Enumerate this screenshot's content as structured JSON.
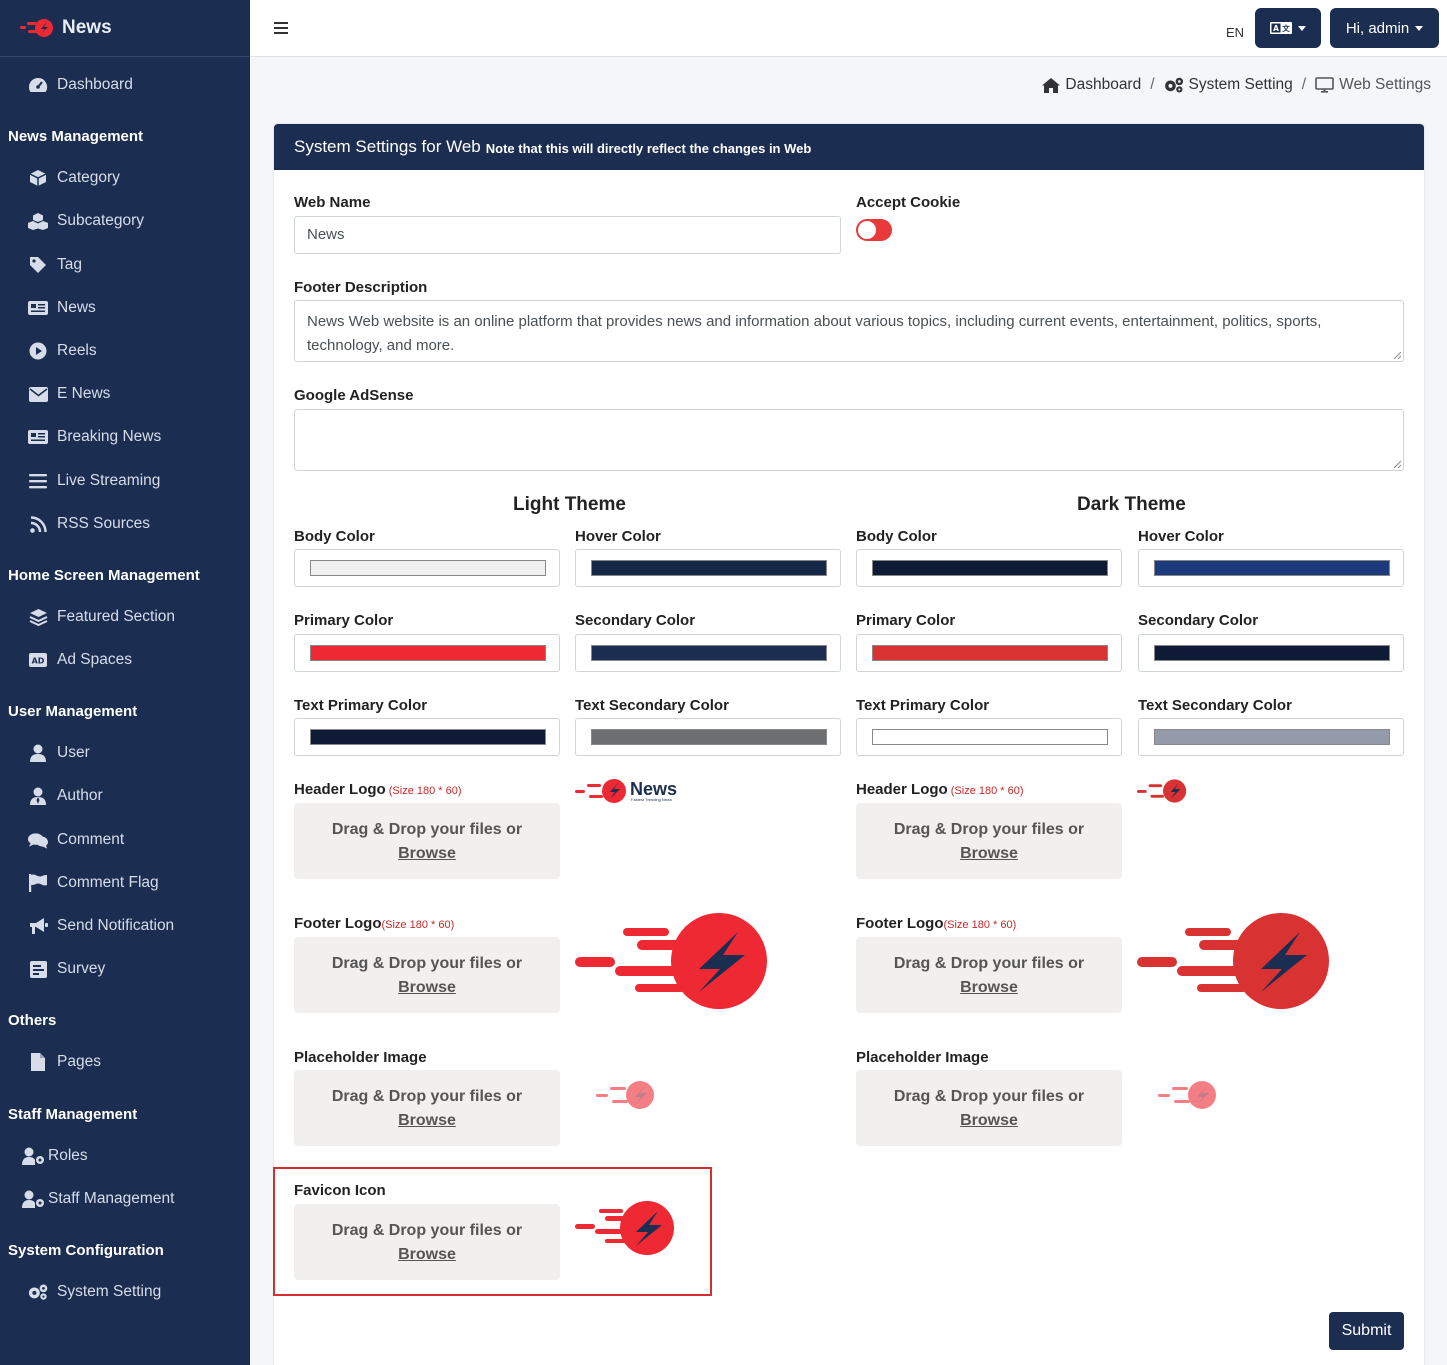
{
  "brand": {
    "name": "News"
  },
  "sidebar": {
    "dashboard": "Dashboard",
    "sections": {
      "news_management": "News Management",
      "home_screen_management": "Home Screen Management",
      "user_management": "User Management",
      "others": "Others",
      "staff_management": "Staff Management",
      "system_configuration": "System Configuration"
    },
    "items": {
      "category": "Category",
      "subcategory": "Subcategory",
      "tag": "Tag",
      "news": "News",
      "reels": "Reels",
      "enews": "E News",
      "breaking_news": "Breaking News",
      "live_streaming": "Live Streaming",
      "rss_sources": "RSS Sources",
      "featured_section": "Featured Section",
      "ad_spaces": "Ad Spaces",
      "user": "User",
      "author": "Author",
      "comment": "Comment",
      "comment_flag": "Comment Flag",
      "send_notification": "Send Notification",
      "survey": "Survey",
      "pages": "Pages",
      "roles": "Roles",
      "staff_management": "Staff Management",
      "system_setting": "System Setting"
    }
  },
  "topbar": {
    "lang": "EN",
    "user_menu": "Hi, admin"
  },
  "breadcrumb": {
    "dashboard": "Dashboard",
    "system_setting": "System Setting",
    "web_settings": "Web Settings"
  },
  "card": {
    "title": "System Settings for Web",
    "note": "Note that this will directly reflect the changes in Web"
  },
  "form": {
    "web_name_label": "Web Name",
    "web_name_value": "News",
    "accept_cookie_label": "Accept Cookie",
    "accept_cookie_on": true,
    "footer_description_label": "Footer Description",
    "footer_description_value": "News Web website is an online platform that provides news and information about various topics, including current events, entertainment, politics, sports, technology, and more.",
    "google_adsense_label": "Google AdSense",
    "google_adsense_value": ""
  },
  "themes": {
    "light_title": "Light Theme",
    "dark_title": "Dark Theme",
    "labels": {
      "body": "Body Color",
      "hover": "Hover Color",
      "primary": "Primary Color",
      "secondary": "Secondary Color",
      "text_primary": "Text Primary Color",
      "text_secondary": "Text Secondary Color"
    },
    "light_colors": {
      "body": "#f0f0f0",
      "hover": "#172748",
      "primary": "#ee2934",
      "secondary": "#1b2d51",
      "text_primary": "#0e1a36",
      "text_secondary": "#6d6e70"
    },
    "dark_colors": {
      "body": "#0e1a36",
      "hover": "#1d3a7d",
      "primary": "#d83232",
      "secondary": "#0e1a36",
      "text_primary": "#ffffff",
      "text_secondary": "#949aaa"
    }
  },
  "uploads": {
    "header_logo_label": "Header Logo",
    "footer_logo_label": "Footer Logo",
    "placeholder_label": "Placeholder Image",
    "favicon_label": "Favicon Icon",
    "size_hint_paren": " (Size 180 * 60)",
    "size_hint": "(Size 180 * 60)",
    "drop_text": "Drag & Drop your files or",
    "browse_text": "Browse",
    "logo_word": "News",
    "logo_tagline": "Fastest Trending News"
  },
  "submit_label": "Submit",
  "colors": {
    "navy": "#1b2d51",
    "brand_red": "#ee2934"
  }
}
